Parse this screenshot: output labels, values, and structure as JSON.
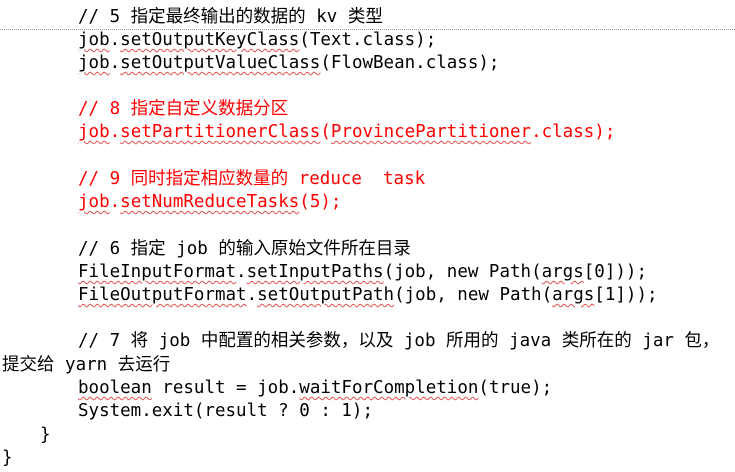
{
  "code": {
    "comment_5": "// 5 指定最终输出的数据的 kv 类型",
    "line_set_key_class": {
      "obj": "job",
      "dot": ".",
      "method": "setOutputKeyClass",
      "args": "(Text.class);"
    },
    "line_set_value_class": {
      "obj": "job",
      "dot": ".",
      "method": "setOutputValueClass",
      "args": "(FlowBean.class);"
    },
    "comment_8": "// 8 指定自定义数据分区",
    "line_set_partitioner": {
      "obj": "job",
      "dot": ".",
      "method": "setPartitionerClass",
      "open": "(",
      "arg": "ProvincePartitioner",
      "close": ".class);"
    },
    "comment_9": "// 9 同时指定相应数量的 reduce  task",
    "line_set_reduce_tasks": {
      "obj": "job",
      "dot": ".",
      "method": "setNumReduceTasks",
      "args": "(5);"
    },
    "comment_6": "// 6 指定 job 的输入原始文件所在目录",
    "line_input_paths": {
      "cls": "FileInputFormat",
      "dot": ".",
      "method": "setInputPaths",
      "mid": "(job, new Path(",
      "args": "args",
      "tail": "[0]));"
    },
    "line_output_path": {
      "cls": "FileOutputFormat",
      "dot": ".",
      "method": "setOutputPath",
      "mid": "(job, new Path(",
      "args": "args",
      "tail": "[1]));"
    },
    "comment_7a": "// 7 将 job 中配置的相关参数，以及 job 所用的 java 类所在的 jar 包，",
    "comment_7b": "提交给 yarn 去运行",
    "line_wait": {
      "type": "boolean",
      "mid": " result = job.",
      "method": "waitForCompletion",
      "args": "(true);"
    },
    "line_exit": "System.exit(result ? 0 : 1);",
    "brace_inner": "}",
    "brace_outer": "}"
  },
  "colors": {
    "text": "#000000",
    "highlight": "#ff0000",
    "spellcheck": "#e05050"
  }
}
